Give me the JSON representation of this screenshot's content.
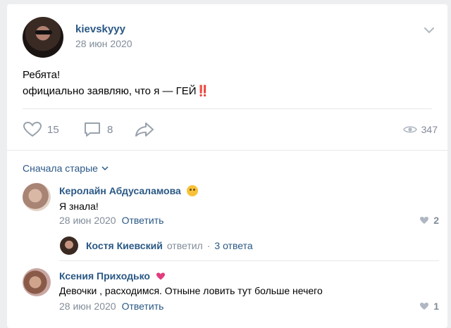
{
  "post": {
    "author": "kievskyyy",
    "date": "28 июн 2020",
    "text_line1": "Ребята!",
    "text_line2": "официально заявляю, что я — ГЕЙ",
    "text_emoji": "‼️",
    "likes": "15",
    "comments": "8",
    "views": "347"
  },
  "comments_section": {
    "sort_label": "Сначала старые",
    "items": [
      {
        "name": "Керолайн Абдусаламова",
        "text": "Я знала!",
        "date": "28 июн 2020",
        "reply_label": "Ответить",
        "likes": "2"
      },
      {
        "name": "Ксения Приходько",
        "text": "Девочки , расходимся. Отныне ловить тут больше нечего",
        "date": "28 июн 2020",
        "reply_label": "Ответить",
        "likes": "1"
      }
    ],
    "thread": {
      "name": "Костя Киевский",
      "action": "ответил",
      "dot": "·",
      "replies": "3 ответа"
    }
  },
  "colors": {
    "link": "#2a5885",
    "meta": "#818c99",
    "background": "#edeef0"
  }
}
